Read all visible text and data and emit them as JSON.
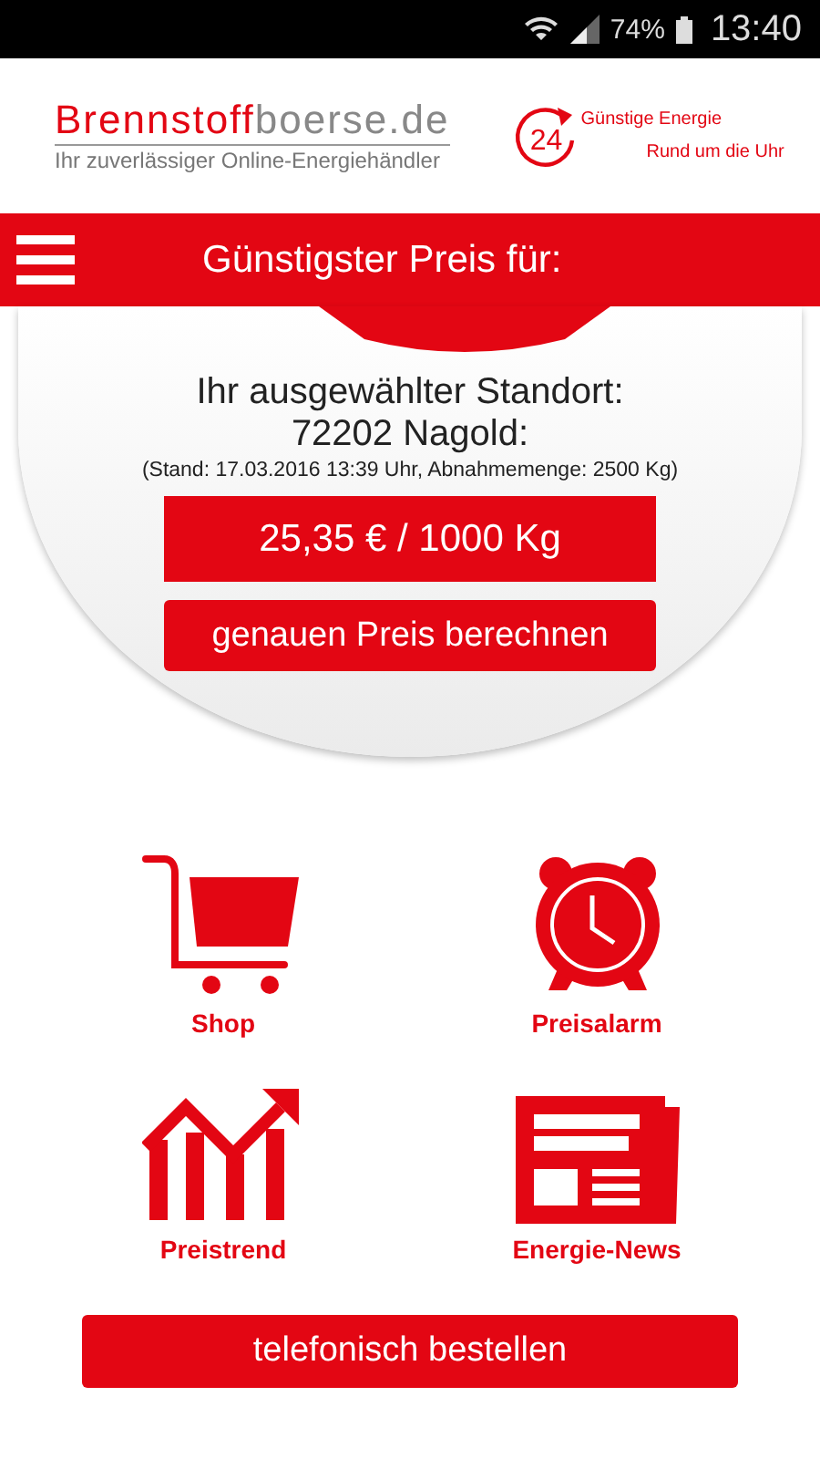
{
  "status_bar": {
    "battery": "74%",
    "time": "13:40"
  },
  "header": {
    "logo": {
      "brand": "Brennstoff",
      "domain": "boerse.de",
      "tagline": "Ihr zuverlässiger Online-Energiehändler"
    },
    "badge": {
      "number": "24",
      "line_1": "Günstige Energie",
      "line_2": "Rund um die Uhr"
    }
  },
  "banner": {
    "title": "Günstigster Preis für:"
  },
  "price_panel": {
    "location_label": "Ihr ausgewählter Standort:",
    "location": "72202 Nagold:",
    "note": "(Stand: 17.03.2016 13:39 Uhr, Abnahmemenge: 2500 Kg)",
    "price": "25,35 € / 1000 Kg",
    "calc_button": "genauen Preis berechnen"
  },
  "menu": [
    {
      "kind": "cart",
      "label": "Shop"
    },
    {
      "kind": "clock",
      "label": "Preisalarm"
    },
    {
      "kind": "chart",
      "label": "Preistrend"
    },
    {
      "kind": "newspaper",
      "label": "Energie-News"
    }
  ],
  "order_button": "telefonisch bestellen"
}
